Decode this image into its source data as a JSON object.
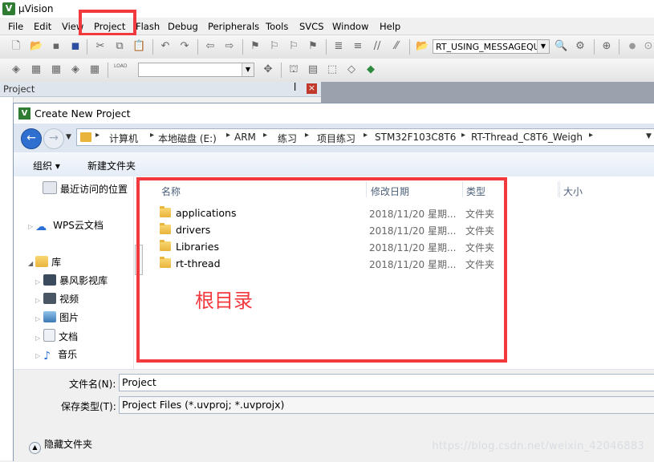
{
  "window": {
    "title": "µVision",
    "logo": "V"
  },
  "menu": [
    "File",
    "Edit",
    "View",
    "Project",
    "Flash",
    "Debug",
    "Peripherals",
    "Tools",
    "SVCS",
    "Window",
    "Help"
  ],
  "toolbar": {
    "target_combo": "RT_USING_MESSAGEQUE",
    "blank_combo": "",
    "load_label": "LOAD"
  },
  "project_pane": {
    "title": "Project",
    "pin": "ᵖ",
    "close": "×"
  },
  "dialog": {
    "title": "Create New Project",
    "breadcrumbs": [
      "计算机",
      "本地磁盘 (E:)",
      "ARM",
      "练习",
      "项目练习",
      "STM32F103C8T6",
      "RT-Thread_C8T6_Weigh"
    ],
    "organize": "组织 ▾",
    "new_folder": "新建文件夹",
    "nav": [
      {
        "label": "最近访问的位置",
        "icon": "recent-places-icon"
      },
      {
        "label": "WPS云文档",
        "icon": "cloud-icon"
      },
      {
        "label": "库",
        "icon": "library-icon"
      },
      {
        "label": "暴风影视库",
        "icon": "video-library-icon"
      },
      {
        "label": "视频",
        "icon": "video-icon"
      },
      {
        "label": "图片",
        "icon": "picture-icon"
      },
      {
        "label": "文档",
        "icon": "document-icon"
      },
      {
        "label": "音乐",
        "icon": "music-icon"
      }
    ],
    "columns": {
      "name": "名称",
      "date": "修改日期",
      "type": "类型",
      "size": "大小"
    },
    "files": [
      {
        "name": "applications",
        "date": "2018/11/20 星期...",
        "type": "文件夹"
      },
      {
        "name": "drivers",
        "date": "2018/11/20 星期...",
        "type": "文件夹"
      },
      {
        "name": "Libraries",
        "date": "2018/11/20 星期...",
        "type": "文件夹"
      },
      {
        "name": "rt-thread",
        "date": "2018/11/20 星期...",
        "type": "文件夹"
      }
    ],
    "filename_label": "文件名(N):",
    "filename_value": "Project",
    "filetype_label": "保存类型(T):",
    "filetype_value": "Project Files (*.uvproj; *.uvprojx)",
    "hide_folders": "隐藏文件夹"
  },
  "annotation": {
    "text": "根目录",
    "color": "#f2393d"
  },
  "watermark": "https://blog.csdn.net/weixin_42046883"
}
